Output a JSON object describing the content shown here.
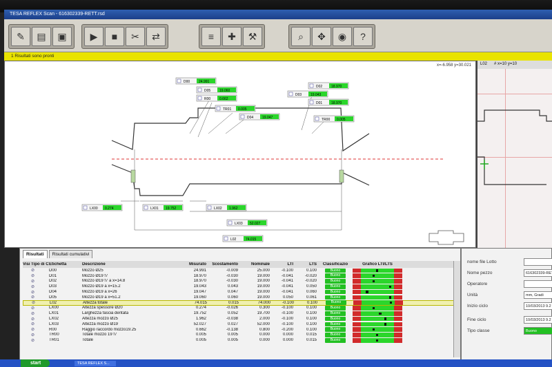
{
  "window": {
    "title": "TESA REFLEX Scan - 616302339-RETT.rsd"
  },
  "status": {
    "message": "1 Risultati sono pronti"
  },
  "coords": "x=-6.958 y=30.021",
  "side": {
    "tab": "L02",
    "grid": "# x=10 y=10"
  },
  "toolbar": [
    {
      "icon": "open-icon",
      "glyph": "✎"
    },
    {
      "icon": "folder-icon",
      "glyph": "▤"
    },
    {
      "icon": "save-icon",
      "glyph": "▣"
    },
    {
      "icon": "start-scan-icon",
      "glyph": "▶"
    },
    {
      "icon": "stop-icon",
      "glyph": "■"
    },
    {
      "icon": "measure-icon",
      "glyph": "✂"
    },
    {
      "icon": "fit-icon",
      "glyph": "⇄"
    },
    {
      "icon": "align-icon",
      "glyph": "≡"
    },
    {
      "icon": "center-icon",
      "glyph": "✚"
    },
    {
      "icon": "tools-icon",
      "glyph": "⚒"
    },
    {
      "icon": "zoom-icon",
      "glyph": "⌕"
    },
    {
      "icon": "pan-icon",
      "glyph": "✥"
    },
    {
      "icon": "view-icon",
      "glyph": "◉"
    },
    {
      "icon": "help-icon",
      "glyph": "?"
    }
  ],
  "callouts": [
    {
      "label": "D00",
      "value": "24.991"
    },
    {
      "label": "D05",
      "value": "19.060"
    },
    {
      "label": "R00",
      "value": "0.662"
    },
    {
      "label": "TR01",
      "value": "0.005"
    },
    {
      "label": "D04",
      "value": "19.047"
    },
    {
      "label": "D02",
      "value": "18.970"
    },
    {
      "label": "D03",
      "value": "19.043"
    },
    {
      "label": "D01",
      "value": "18.970"
    },
    {
      "label": "TR00",
      "value": "0.005"
    },
    {
      "label": "LX00",
      "value": "0.274"
    },
    {
      "label": "LX01",
      "value": "19.752"
    },
    {
      "label": "LX02",
      "value": "1.962"
    },
    {
      "label": "LX03",
      "value": "52.027"
    },
    {
      "label": "L02",
      "value": "74.015"
    }
  ],
  "tabs": [
    "Risultati",
    "Risultati cumulativi"
  ],
  "table": {
    "headers": [
      "Visi",
      "Tipo di C",
      "Etichetta",
      "Descrizione",
      "Misurato",
      "Scostamento",
      "Nominale",
      "LTI",
      "LTS",
      "Classificazio",
      "Grafico LTI/LTS"
    ],
    "rows": [
      {
        "label": "D00",
        "desc": "Mozzo Ø25",
        "meas": "24.991",
        "dev": "-0.009",
        "nom": "25.000",
        "lti": "-0.100",
        "lts": "0.100",
        "cls": "Buono",
        "mark": 0.45
      },
      {
        "label": "D01",
        "desc": "Mozzo Ø19 f7",
        "meas": "18.970",
        "dev": "-0.030",
        "nom": "19.000",
        "lti": "-0.041",
        "lts": "-0.020",
        "cls": "Buono",
        "mark": 0.35
      },
      {
        "label": "D02",
        "desc": "Mozzo Ø19 f7 a x=14.8",
        "meas": "18.970",
        "dev": "-0.030",
        "nom": "19.000",
        "lti": "-0.041",
        "lts": "-0.020",
        "cls": "Buono",
        "mark": 0.35
      },
      {
        "label": "D03",
        "desc": "Mozzo Ø19 a x=15.2",
        "meas": "19.043",
        "dev": "0.043",
        "nom": "19.000",
        "lti": "-0.041",
        "lts": "0.050",
        "cls": "Buono",
        "mark": 0.85
      },
      {
        "label": "D04",
        "desc": "Mozzo Ø19 a x=26",
        "meas": "19.047",
        "dev": "0.047",
        "nom": "19.000",
        "lti": "-0.041",
        "lts": "0.060",
        "cls": "Buono",
        "mark": 0.15
      },
      {
        "label": "D05",
        "desc": "Mozzo Ø19 a x=51.2",
        "meas": "19.060",
        "dev": "0.060",
        "nom": "19.000",
        "lti": "0.050",
        "lts": "0.061",
        "cls": "Buono",
        "mark": 0.85
      },
      {
        "label": "L02",
        "desc": "Altezza totale",
        "meas": "74.015",
        "dev": "0.015",
        "nom": "74.000",
        "lti": "-0.100",
        "lts": "0.100",
        "cls": "Buono",
        "mark": 0.85,
        "selected": true
      },
      {
        "label": "LX00",
        "desc": "Altezza spessore Ø20",
        "meas": "0.274",
        "dev": "-0.026",
        "nom": "0.300",
        "lti": "-0.100",
        "lts": "0.100",
        "cls": "Buono",
        "mark": 0.35
      },
      {
        "label": "LX01",
        "desc": "Larghezza fascia dentata",
        "meas": "19.752",
        "dev": "0.052",
        "nom": "19.700",
        "lti": "-0.100",
        "lts": "0.100",
        "cls": "Buono",
        "mark": 0.55
      },
      {
        "label": "LX02",
        "desc": "Altezza mozzo Ø25",
        "meas": "1.962",
        "dev": "-0.038",
        "nom": "2.000",
        "lti": "-0.100",
        "lts": "0.100",
        "cls": "Buono",
        "mark": 0.7
      },
      {
        "label": "LX03",
        "desc": "Altezza mozzo Ø19",
        "meas": "52.027",
        "dev": "0.027",
        "nom": "52.000",
        "lti": "-0.100",
        "lts": "0.100",
        "cls": "Buono",
        "mark": 0.7
      },
      {
        "label": "R00",
        "desc": "Raggio raccordo mozzo19.25",
        "meas": "0.662",
        "dev": "-0.138",
        "nom": "0.800",
        "lti": "-0.200",
        "lts": "0.100",
        "cls": "Buono",
        "mark": 0.35
      },
      {
        "label": "TR00",
        "desc": "Totale mozzo 19 f7",
        "meas": "0.005",
        "dev": "0.005",
        "nom": "0.000",
        "lti": "0.000",
        "lts": "0.015",
        "cls": "Buono",
        "mark": 0.45
      },
      {
        "label": "TR01",
        "desc": "Totale",
        "meas": "0.005",
        "dev": "0.005",
        "nom": "0.000",
        "lti": "0.000",
        "lts": "0.015",
        "cls": "Buono",
        "mark": 0.45
      }
    ]
  },
  "info": [
    {
      "label": "nome file Lotto",
      "value": ""
    },
    {
      "label": "Nome pezzo",
      "value": "616302339-RETT"
    },
    {
      "label": "Operatore",
      "value": ""
    },
    {
      "label": "Unità",
      "value": "mm, Gradi"
    },
    {
      "label": "Inizio ciclo",
      "value": "10/03/2013 9.2"
    },
    {
      "label": "Fine ciclo",
      "value": "10/03/2013 9.2"
    },
    {
      "label": "Tipo classe",
      "value": "Buono",
      "green": true
    }
  ],
  "taskbar": {
    "start": "start",
    "item": "TESA REFLEX S..."
  },
  "colors": {
    "buono": "#22c022",
    "status": "#e9e300",
    "limit": "#d12b2b"
  }
}
